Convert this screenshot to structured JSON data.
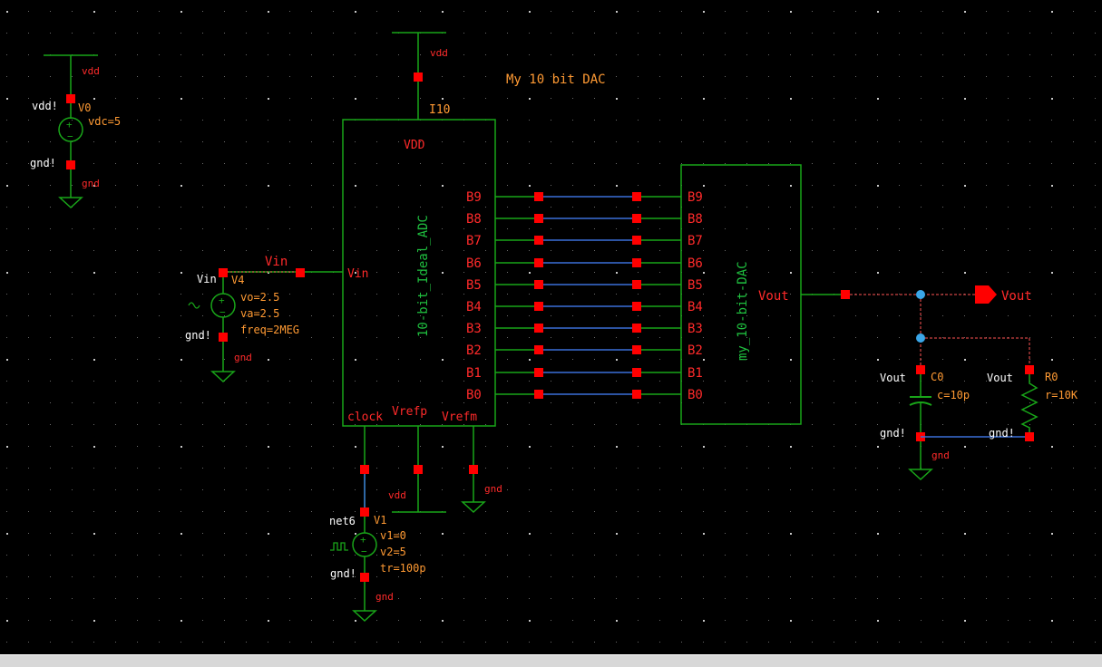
{
  "title": "My 10 bit DAC",
  "colors": {
    "background": "#000000",
    "wire": "#19a519",
    "net": "#3a6fd8",
    "pin": "#ff0000",
    "label_orange": "#ff9a33",
    "label_red": "#ff2a2a",
    "instance_green": "#1fbf3f",
    "grid_dot": "#8a8a8a",
    "junction": "#3aa6e8",
    "statusbar": "#d8d8d8"
  },
  "supply": {
    "net_top": "vdd",
    "pin_top": "vdd!",
    "inst": "V0",
    "param": "vdc=5",
    "pin_bottom": "gnd!",
    "net_bottom": "gnd"
  },
  "vin_source": {
    "pin_top": "Vin",
    "inst": "V4",
    "params": [
      "vo=2.5",
      "va=2.5",
      "freq=2MEG"
    ],
    "pin_bottom": "gnd!",
    "net_bottom": "gnd",
    "net_label": "Vin"
  },
  "adc": {
    "inst": "I10",
    "net_top": "vdd",
    "cell": "10-bit_Ideal_ADC",
    "pin_vdd": "VDD",
    "pin_vin": "Vin",
    "pin_clock": "clock",
    "pin_vrefp": "Vrefp",
    "pin_vrefm": "Vrefm",
    "net_vrefp": "vdd",
    "net_vrefm": "gnd",
    "outputs": [
      "B9",
      "B8",
      "B7",
      "B6",
      "B5",
      "B4",
      "B3",
      "B2",
      "B1",
      "B0"
    ]
  },
  "dac": {
    "cell": "my_10-bit-DAC",
    "inputs": [
      "B9",
      "B8",
      "B7",
      "B6",
      "B5",
      "B4",
      "B3",
      "B2",
      "B1",
      "B0"
    ],
    "pin_out": "Vout"
  },
  "clock_source": {
    "pin_top": "net6",
    "inst": "V1",
    "params": [
      "v1=0",
      "v2=5",
      "tr=100p"
    ],
    "pin_bottom": "gnd!",
    "net_bottom": "gnd"
  },
  "output": {
    "pin": "Vout",
    "cap": {
      "pin_top": "Vout",
      "inst": "C0",
      "param": "c=10p",
      "pin_bottom": "gnd!",
      "net_bottom": "gnd"
    },
    "res": {
      "pin_top": "Vout",
      "inst": "R0",
      "param": "r=10K",
      "pin_bottom": "gnd!"
    }
  }
}
